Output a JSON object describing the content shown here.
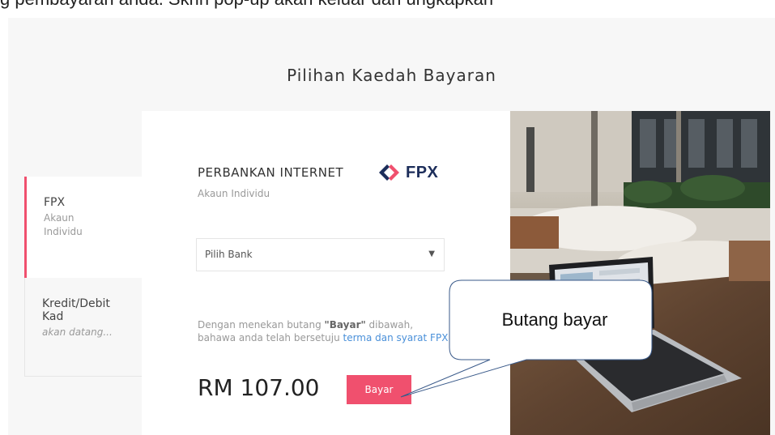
{
  "caption": {
    "text": "g pembayaran anda. Skrin pop-up akan keluar dan ungkapkan"
  },
  "page": {
    "title": "Pilihan Kaedah Bayaran"
  },
  "tabs": [
    {
      "title": "FPX",
      "subtitle": "Akaun Individu",
      "active": true
    },
    {
      "title": "Kredit/Debit Kad",
      "subtitle": "akan datang...",
      "active": false
    }
  ],
  "fpx": {
    "heading": "PERBANKAN INTERNET",
    "logo_text": "FPX",
    "logo_color": "#1c2d5a",
    "logo_accent": "#f0506e",
    "account_label": "Akaun Individu"
  },
  "bank_select": {
    "placeholder": "Pilih Bank",
    "caret": "▼"
  },
  "terms": {
    "prefix": "Dengan menekan butang ",
    "button_name": "\"Bayar\"",
    "middle": " dibawah, bahawa anda telah bersetuju ",
    "link_text": "terma dan syarat FPX"
  },
  "payment": {
    "amount": "RM 107.00",
    "pay_label": "Bayar",
    "accent_color": "#f0506e"
  },
  "callout": {
    "text": "Butang bayar"
  }
}
